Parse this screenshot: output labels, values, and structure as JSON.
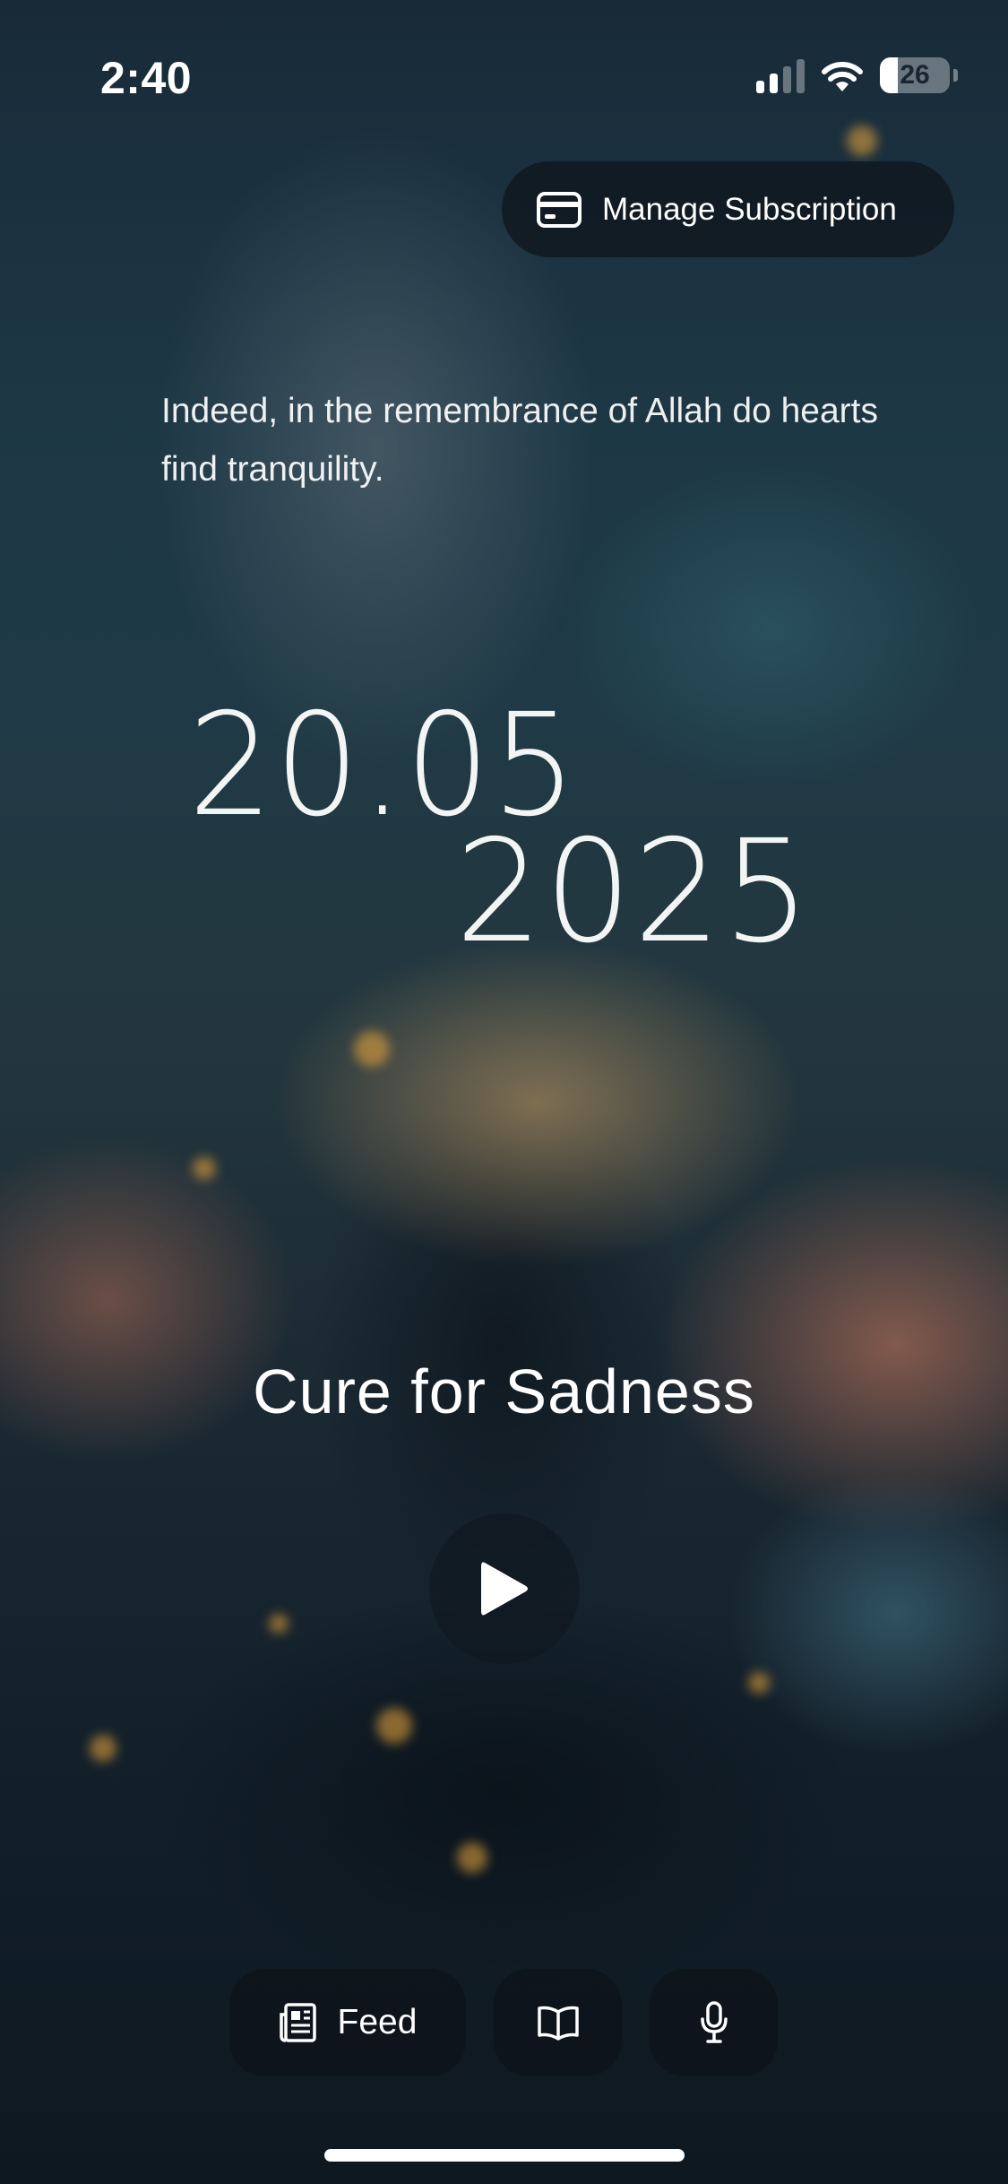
{
  "status_bar": {
    "time": "2:40",
    "battery_percent": "26",
    "battery_level": 0.26,
    "signal_bars_active": 2,
    "signal_bars_total": 4
  },
  "header": {
    "manage_subscription_label": "Manage Subscription",
    "manage_subscription_icon": "credit-card-icon"
  },
  "quote": {
    "text": "Indeed, in the remembrance of Allah do hearts find tranquility."
  },
  "date": {
    "day_month": "20.05",
    "year": "2025"
  },
  "player": {
    "title": "Cure for Sadness",
    "play_icon": "play-icon"
  },
  "bottom_nav": {
    "feed_label": "Feed",
    "feed_icon": "newspaper-icon",
    "book_icon": "book-icon",
    "mic_icon": "microphone-icon"
  },
  "colors": {
    "button_bg": "#0e161e",
    "text": "#ffffff",
    "sky_top": "#182a38",
    "sky_glow": "#cca066"
  }
}
